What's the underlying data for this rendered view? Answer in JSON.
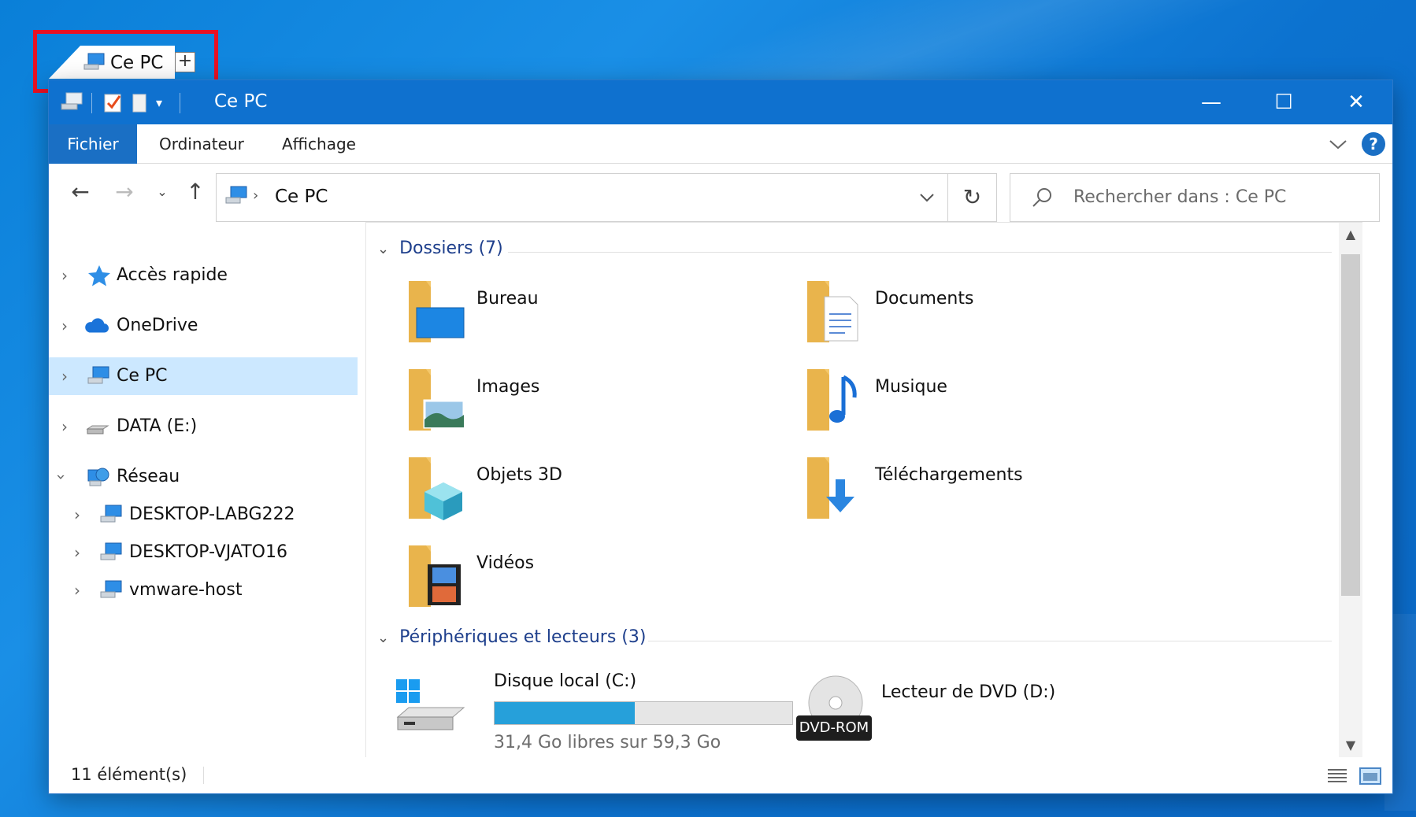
{
  "tab": {
    "label": "Ce PC",
    "new_tab_symbol": "+"
  },
  "window": {
    "title": "Ce PC",
    "controls": {
      "minimize": "—",
      "maximize": "☐",
      "close": "✕"
    }
  },
  "ribbon": {
    "tabs": [
      "Fichier",
      "Ordinateur",
      "Affichage"
    ],
    "help": "?"
  },
  "address": {
    "path": "Ce PC",
    "search_placeholder": "Rechercher dans : Ce PC"
  },
  "nav": {
    "items": [
      {
        "label": "Accès rapide",
        "icon": "star-icon",
        "expanded": false
      },
      {
        "label": "OneDrive",
        "icon": "cloud-icon",
        "expanded": false
      },
      {
        "label": "Ce PC",
        "icon": "computer-icon",
        "expanded": false,
        "selected": true
      },
      {
        "label": "DATA (E:)",
        "icon": "drive-icon",
        "expanded": false
      },
      {
        "label": "Réseau",
        "icon": "network-icon",
        "expanded": true
      }
    ],
    "network_children": [
      "DESKTOP-LABG222",
      "DESKTOP-VJATO16",
      "vmware-host"
    ]
  },
  "content": {
    "folders_header": "Dossiers (7)",
    "folders": [
      {
        "label": "Bureau",
        "icon": "desktop-folder-icon"
      },
      {
        "label": "Documents",
        "icon": "documents-folder-icon"
      },
      {
        "label": "Images",
        "icon": "pictures-folder-icon"
      },
      {
        "label": "Musique",
        "icon": "music-folder-icon"
      },
      {
        "label": "Objets 3D",
        "icon": "3d-objects-folder-icon"
      },
      {
        "label": "Téléchargements",
        "icon": "downloads-folder-icon"
      },
      {
        "label": "Vidéos",
        "icon": "videos-folder-icon"
      }
    ],
    "devices_header": "Périphériques et lecteurs (3)",
    "drives": [
      {
        "label": "Disque local (C:)",
        "free_text": "31,4 Go libres sur 59,3 Go",
        "used_fraction": 0.47
      },
      {
        "label": "Lecteur de DVD (D:)",
        "badge": "DVD-ROM"
      }
    ]
  },
  "status": {
    "count": "11 élément(s)"
  },
  "colors": {
    "accent": "#0f71cf",
    "selection": "#cce8ff",
    "drive_fill": "#26a0da",
    "group_header": "#1e3f8c",
    "highlight_box": "#e81123"
  }
}
